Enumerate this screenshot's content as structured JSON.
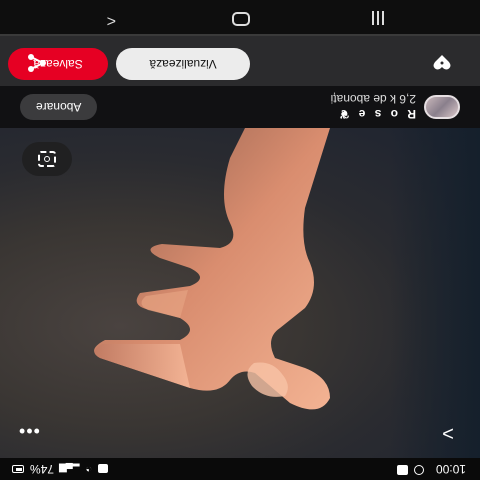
{
  "status_bar": {
    "time": "10:00",
    "battery": "74%"
  },
  "photo": {
    "next_glyph": ">",
    "more_glyph": "•••",
    "lens_icon": "visual-search-icon"
  },
  "profile": {
    "name": "R o s e",
    "name_icon": "feather-icon",
    "subscribers": "2,6 k de abonați",
    "subscribe_label": "Abonare"
  },
  "actions": {
    "visit_label": "Vizualizează",
    "save_label": "Salvează",
    "save_color": "#e60023",
    "heart_icon": "heart-icon",
    "share_icon": "share-icon"
  },
  "nav": {
    "back_glyph": "<",
    "recents_icon": "recents-icon",
    "home_icon": "home-icon"
  }
}
